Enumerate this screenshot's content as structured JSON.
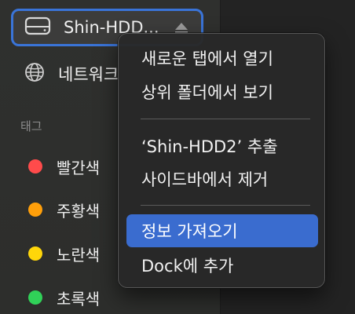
{
  "sidebar": {
    "selected_drive": {
      "label": "Shin-HDD...",
      "drive_icon": "external-drive-icon",
      "eject_icon": "eject-icon",
      "accent": "#3a74d8"
    },
    "network": {
      "label": "네트워크",
      "icon": "globe-icon"
    },
    "tags_section": {
      "title": "태그",
      "items": [
        {
          "label": "빨간색",
          "color": "#ff4b4b"
        },
        {
          "label": "주황색",
          "color": "#ff9f0a"
        },
        {
          "label": "노란색",
          "color": "#ffd60a"
        },
        {
          "label": "초록색",
          "color": "#30d158"
        }
      ]
    }
  },
  "context_menu": {
    "items": [
      {
        "label": "새로운 탭에서 열기"
      },
      {
        "label": "상위 폴더에서 보기"
      },
      {
        "label": "‘Shin-HDD2’ 추출"
      },
      {
        "label": "사이드바에서 제거"
      },
      {
        "label": "정보 가져오기",
        "highlighted": true
      },
      {
        "label": "Dock에 추가"
      }
    ],
    "highlight_color": "#3a6ccf"
  }
}
